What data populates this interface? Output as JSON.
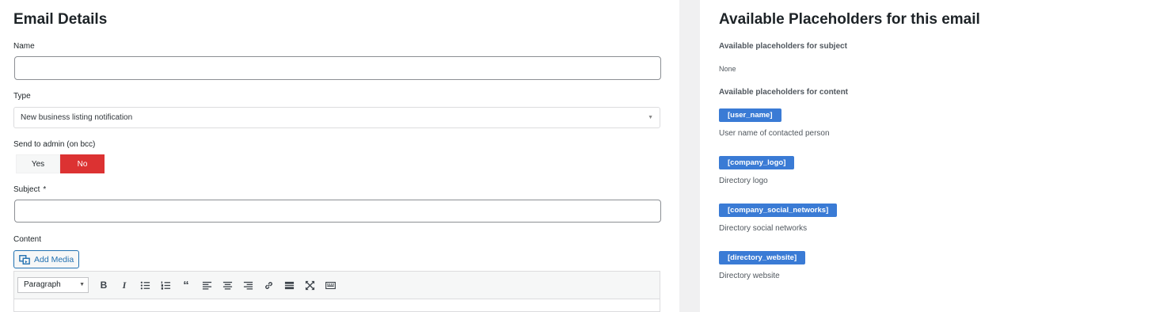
{
  "left": {
    "title": "Email Details",
    "name_label": "Name",
    "name_value": "",
    "type_label": "Type",
    "type_value": "New business listing notification",
    "send_admin_label": "Send to admin (on bcc)",
    "toggle": {
      "yes": "Yes",
      "no": "No",
      "selected": "No"
    },
    "subject_label": "Subject",
    "subject_required_mark": "*",
    "subject_value": "",
    "content_label": "Content",
    "add_media_label": "Add Media",
    "editor": {
      "format_select": "Paragraph",
      "buttons": [
        "bold",
        "italic",
        "bulleted-list",
        "numbered-list",
        "blockquote",
        "align-left",
        "align-center",
        "align-right",
        "insert-link",
        "read-more",
        "fullscreen",
        "toolbar-toggle"
      ]
    }
  },
  "right": {
    "title": "Available Placeholders for this email",
    "subject_heading": "Available placeholders for subject",
    "subject_none": "None",
    "content_heading": "Available placeholders for content",
    "placeholders": [
      {
        "tag": "[user_name]",
        "description": "User name of contacted person"
      },
      {
        "tag": "[company_logo]",
        "description": "Directory logo"
      },
      {
        "tag": "[company_social_networks]",
        "description": "Directory social networks"
      },
      {
        "tag": "[directory_website]",
        "description": "Directory website"
      }
    ]
  },
  "colors": {
    "accent": "#3a7bd5",
    "toggle_no": "#dc3232",
    "gutter": "#f0f0f1"
  }
}
